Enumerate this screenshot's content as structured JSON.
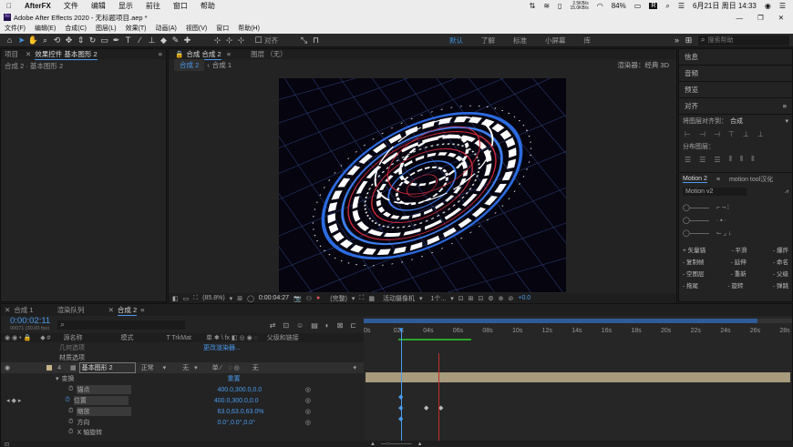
{
  "mac": {
    "app": "AfterFX",
    "menus": [
      "文件",
      "编辑",
      "显示",
      "前往",
      "窗口",
      "帮助"
    ],
    "net_up": "2.5KB/s",
    "net_down": "15.0KB/s",
    "battery": "84%",
    "date": "6月21日 周日 14:33"
  },
  "window": {
    "title": "Adobe After Effects 2020 - 无标题项目.aep *"
  },
  "app_menu": [
    "文件(F)",
    "编辑(E)",
    "合成(C)",
    "图层(L)",
    "效果(T)",
    "动画(A)",
    "视图(V)",
    "窗口",
    "帮助(H)"
  ],
  "toolbar": {
    "align_label": "对齐",
    "workspaces": [
      "默认",
      "了解",
      "标准",
      "小屏幕",
      "库"
    ],
    "active_workspace": "默认",
    "search_placeholder": "搜索帮助"
  },
  "left_panel": {
    "tabs": [
      "项目",
      "效果控件 基本图形 2"
    ],
    "sub": "合成 2 · 基本图形 2"
  },
  "comp_panel": {
    "tab": "合成 合成 2",
    "footage_tab": "图层 （无）",
    "subtabs": [
      "合成 2",
      "合成 1"
    ],
    "renderer": "渲染器：",
    "renderer_value": "经典 3D",
    "zoom": "(85.8%)",
    "timecode": "0:00:04:27",
    "quality": "(完整)",
    "camera": "活动摄像机",
    "views": "1个...",
    "exposure": "+0.0"
  },
  "right_panel": {
    "items": [
      "信息",
      "音频",
      "预览"
    ],
    "align_title": "对齐",
    "align_to_label": "将图层对齐到：",
    "align_to_value": "合成",
    "distribute_label": "分布图层：",
    "motion_tabs": [
      "Motion 2",
      "motion tool汉化"
    ],
    "motion_version": "Motion v2",
    "motion_buttons": [
      [
        "+ 矢量锚",
        "- 平滑",
        "- 爆炸"
      ],
      [
        "- 复制帧",
        "- 延伸",
        "- 命名"
      ],
      [
        "- 空图层",
        "- 重新",
        "- 父级"
      ],
      [
        "- 拖尾",
        "- 旋转",
        "- 弹跳"
      ]
    ]
  },
  "timeline": {
    "tabs": [
      "合成 1",
      "渲染队列",
      "合成 2"
    ],
    "active_tab": "合成 2",
    "timecode": "0:00:02:11",
    "frame_info": "00071 (30.00 fps)",
    "col_headers": [
      "源名称",
      "模式",
      "T TrkMat",
      "父级和链接"
    ],
    "ruler": [
      "0s",
      "02s",
      "04s",
      "06s",
      "08s",
      "10s",
      "12s",
      "14s",
      "16s",
      "18s",
      "20s",
      "22s",
      "24s",
      "26s",
      "28s"
    ],
    "rows": [
      {
        "name": "几何选项",
        "value": "更改渲染器...",
        "indent": 1
      },
      {
        "name": "材质选项",
        "value": "",
        "indent": 1
      },
      {
        "num": "4",
        "name": "基本图形 2",
        "mode": "正常",
        "trk": "无",
        "parent": "无",
        "indent": 0
      },
      {
        "name": "变换",
        "value": "重置",
        "indent": 1
      },
      {
        "name": "锚点",
        "value": "400.0,300.0,0.0",
        "indent": 2
      },
      {
        "name": "位置",
        "value": "400.0,300.0,0.0",
        "indent": 2
      },
      {
        "name": "缩放",
        "value": "63.0,63.0,63.0%",
        "indent": 2
      },
      {
        "name": "方向",
        "value": "0.0°,0.0°,0.0°",
        "indent": 2
      },
      {
        "name": "X 轴旋转",
        "value": "",
        "indent": 2
      }
    ]
  }
}
